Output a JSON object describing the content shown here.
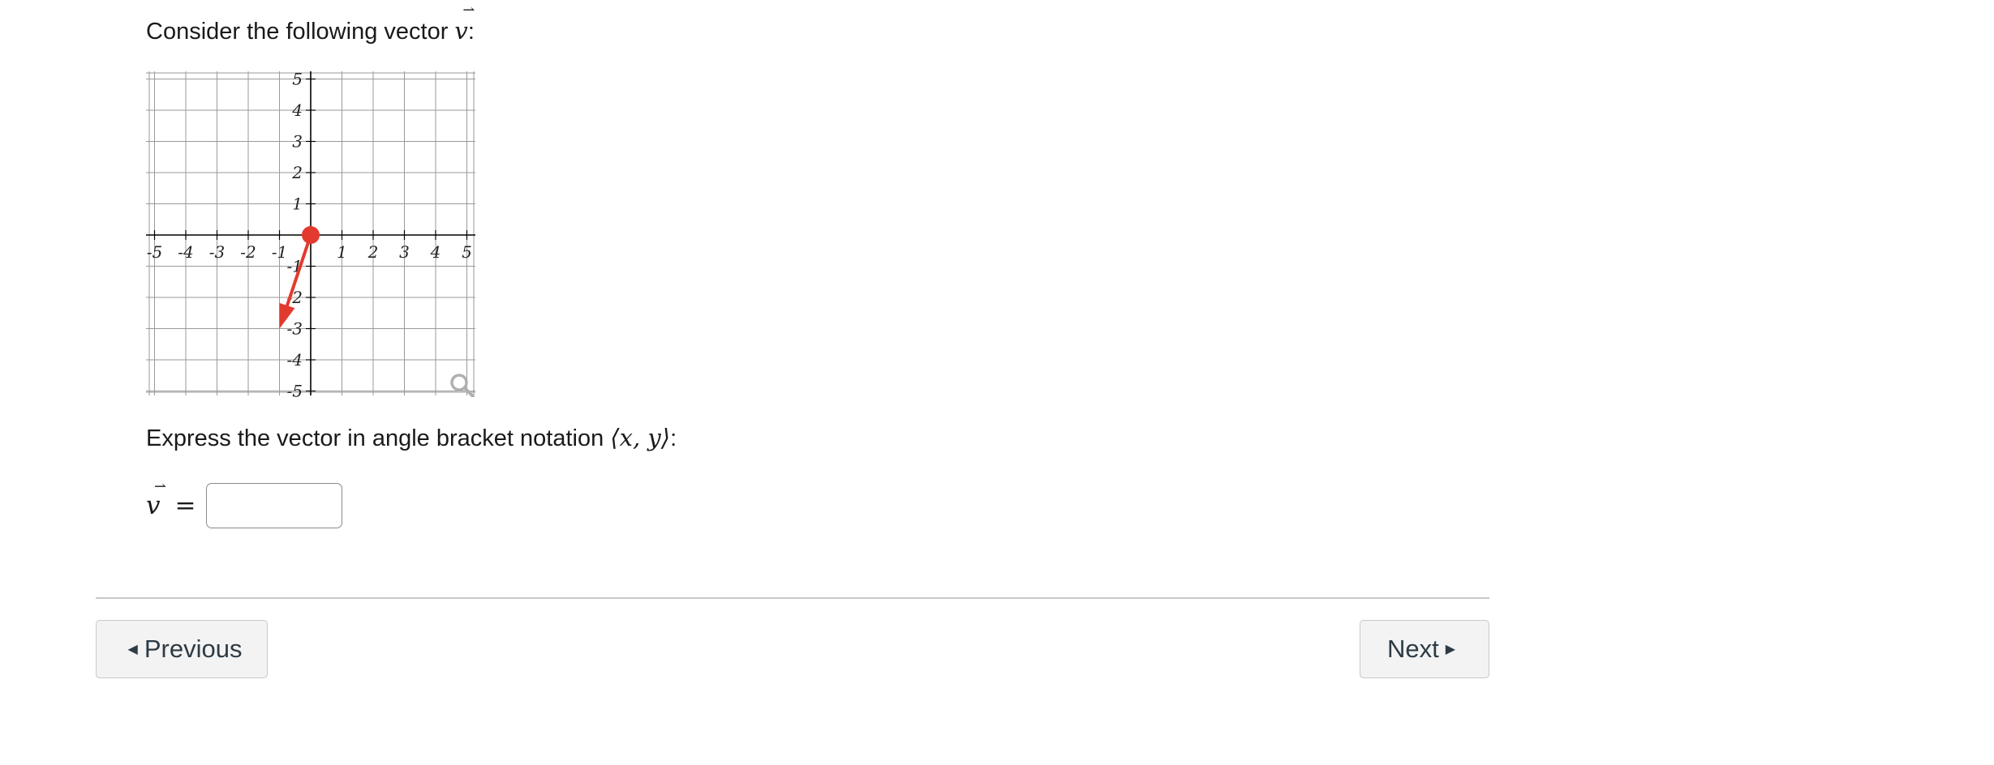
{
  "question": {
    "intro_prefix": "Consider the following vector ",
    "vector_symbol": "v",
    "vector_arrow": "⇀",
    "intro_suffix": ":",
    "express_prefix": "Express the vector in angle bracket notation ",
    "express_notation": "⟨x, y⟩",
    "express_suffix": ":"
  },
  "graph": {
    "x_ticks": [
      "-5",
      "-4",
      "-3",
      "-2",
      "-1",
      "1",
      "2",
      "3",
      "4",
      "5"
    ],
    "y_ticks": [
      "5",
      "4",
      "3",
      "2",
      "1",
      "-1",
      "-2",
      "-3",
      "-4",
      "-5"
    ],
    "vector_color": "#e33a2f",
    "grid_color": "#9a9a9a",
    "zoom_icon": "magnifier-icon"
  },
  "chart_data": {
    "type": "scatter",
    "x_range": [
      -5,
      5
    ],
    "y_range": [
      -5,
      5
    ],
    "grid": true,
    "vector": {
      "tail": [
        0,
        0
      ],
      "head": [
        -1,
        -3
      ]
    }
  },
  "answer": {
    "label_symbol": "v",
    "equals": "=",
    "value": "",
    "placeholder": ""
  },
  "nav": {
    "previous_label": "Previous",
    "next_label": "Next"
  }
}
